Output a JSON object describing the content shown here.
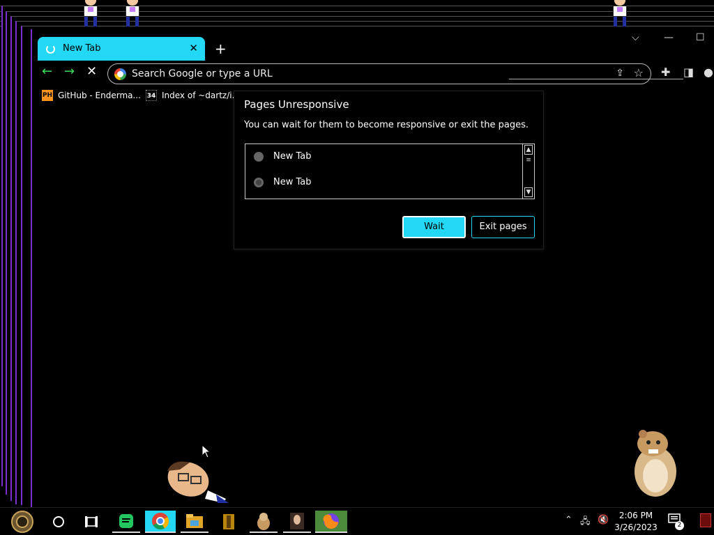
{
  "browser": {
    "tab_title": "New Tab",
    "tab_close": "✕",
    "new_tab": "+",
    "omnibox_placeholder": "Search Google or type a URL",
    "window_controls": {
      "dropdown": "⌵",
      "minimize": "—",
      "maximize": "☐"
    }
  },
  "bookmarks": [
    {
      "label": "GitHub - Enderma...",
      "icon": "ph-favicon",
      "icon_text": "PH",
      "color": "#f7931e"
    },
    {
      "label": "Index of ~dartz/i...",
      "icon": "grid-favicon",
      "icon_text": "34",
      "color": "#ffffff"
    }
  ],
  "dialog": {
    "title": "Pages Unresponsive",
    "message": "You can wait for them to become responsive or exit the pages.",
    "pages": [
      "New Tab",
      "New Tab"
    ],
    "wait_label": "Wait",
    "exit_label": "Exit pages"
  },
  "taskbar": {
    "time": "2:06 PM",
    "date": "3/26/2023",
    "notification_count": "2"
  },
  "colors": {
    "accent": "#22d8f5",
    "frame": "#7b2fd0"
  }
}
